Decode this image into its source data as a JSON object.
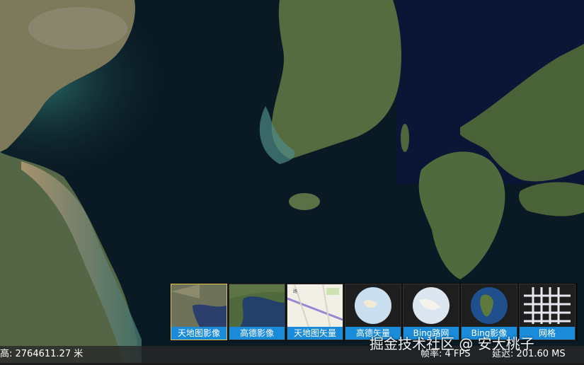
{
  "basemaps": [
    {
      "label": "天地图影像",
      "selected": true,
      "thumb": "satellite-tianditu"
    },
    {
      "label": "高德影像",
      "selected": false,
      "thumb": "satellite-gaode"
    },
    {
      "label": "天地图矢量",
      "selected": false,
      "thumb": "vector-tianditu"
    },
    {
      "label": "高德矢量",
      "selected": false,
      "thumb": "globe-vector"
    },
    {
      "label": "Bing路网",
      "selected": false,
      "thumb": "globe-road"
    },
    {
      "label": "Bing影像",
      "selected": false,
      "thumb": "globe-imagery"
    },
    {
      "label": "网格",
      "selected": false,
      "thumb": "grid"
    }
  ],
  "status": {
    "height": "高: 2764611.27 米",
    "fps": "帧率: 4 FPS",
    "latency": "延迟: 201.60 MS"
  },
  "watermark": "掘金技术社区 @ 安大桃子",
  "colors": {
    "ocean_deep": "#0a1a24",
    "land_green": "#3a5232",
    "land_tan": "#8a8060",
    "label_blue": "#1a8bd8",
    "selected_border": "#e1c25a"
  }
}
